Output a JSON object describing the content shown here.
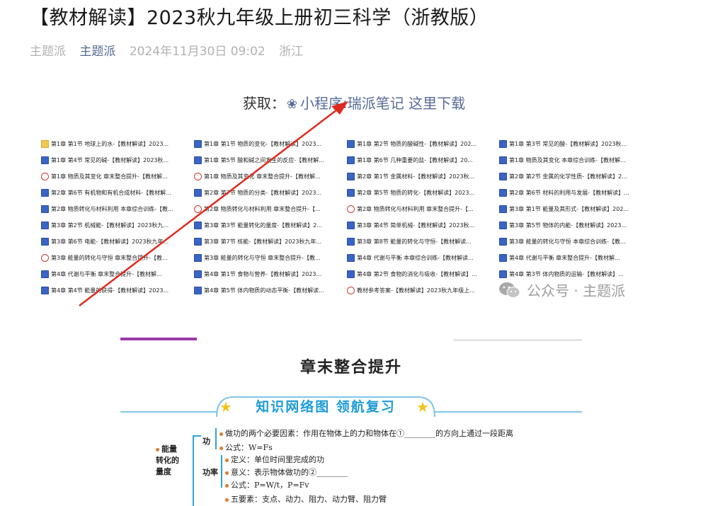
{
  "article": {
    "title": "【教材解读】2023秋九年级上册初三科学（浙教版）",
    "author": "主题派",
    "account": "主题派",
    "datetime": "2024年11月30日 09:02",
    "location": "浙江"
  },
  "get_line": {
    "label": "获取：",
    "icon": "link-icon",
    "link_text": "小程序:瑞派笔记 这里下载"
  },
  "files": {
    "columns": [
      [
        {
          "type": "folder",
          "name": "第1章 第1节 地球上的水-【教材解读】2023..."
        },
        {
          "type": "word",
          "name": "第1章 第4节 常见的碱-【教材解读】2023秋..."
        },
        {
          "type": "pdf",
          "name": "第1章 物质及其变化 章末整合提升-【教材解..."
        },
        {
          "type": "word",
          "name": "第2章 第6节 有机物和有机合成材料-【教材解..."
        },
        {
          "type": "word",
          "name": "第2章 物质转化与材料利用 本章综合训练-【教..."
        },
        {
          "type": "word",
          "name": "第3章 第2节 机械能-【教材解读】2023秋九..."
        },
        {
          "type": "word",
          "name": "第3章 第6节 电能-【教材解读】2023秋九年..."
        },
        {
          "type": "pdf",
          "name": "第3章 能量的转化与守恒 章末整合提升-【教..."
        },
        {
          "type": "word",
          "name": "第4章 代谢与平衡 章末整合提升-【教材解..."
        },
        {
          "type": "word",
          "name": "第4章 第4节 能量的获得-【教材解读】2023..."
        }
      ],
      [
        {
          "type": "word",
          "name": "第1章 第1节 物质的变化-【教材解读】2023..."
        },
        {
          "type": "word",
          "name": "第1章 第5节 酸和碱之间发生的反应-【教材解..."
        },
        {
          "type": "pdf",
          "name": "第1章 物质及其变化 章末整合提升-【教材解..."
        },
        {
          "type": "word",
          "name": "第2章 第7节 物质的分类-【教材解读】2023..."
        },
        {
          "type": "pdf",
          "name": "第2章 物质转化与材料利用 章末整合提升-【..."
        },
        {
          "type": "word",
          "name": "第3章 第3节 能量转化的量度-【教材解读】2..."
        },
        {
          "type": "word",
          "name": "第3章 第7节 核能-【教材解读】2023秋九年..."
        },
        {
          "type": "word",
          "name": "第3章 能量的转化与守恒 章末整合提升-【教..."
        },
        {
          "type": "word",
          "name": "第4章 第1节 食物与营养-【教材解读】2023..."
        },
        {
          "type": "word",
          "name": "第4章 第5节 体内物质的动态平衡-【教材解读..."
        }
      ],
      [
        {
          "type": "word",
          "name": "第1章 第2节 物质的酸碱性-【教材解读】202..."
        },
        {
          "type": "word",
          "name": "第1章 第6节 几种重要的盐-【教材解读】20..."
        },
        {
          "type": "word",
          "name": "第2章 第1节 金属材料-【教材解读】2023秋..."
        },
        {
          "type": "word",
          "name": "第2章 第5节 物质的转化-【教材解读】2023..."
        },
        {
          "type": "pdf",
          "name": "第2章 物质转化与材料利用 章末整合提升-【..."
        },
        {
          "type": "word",
          "name": "第3章 第4节 简单机械-【教材解读】2023秋..."
        },
        {
          "type": "word",
          "name": "第3章 第8节 能量的转化与守恒-【教材解读..."
        },
        {
          "type": "word",
          "name": "第4章 代谢与平衡 本章综合训练-【教材解读..."
        },
        {
          "type": "word",
          "name": "第4章 第2节 食物的消化与吸收-【教材解读】..."
        },
        {
          "type": "pdf",
          "name": "教材参考答案-【教材解读】2023秋九年级上..."
        }
      ],
      [
        {
          "type": "word",
          "name": "第1章 第3节 常见的酸-【教材解读】2023秋..."
        },
        {
          "type": "word",
          "name": "第1章 物质及其变化 本章综合训练-【教材解..."
        },
        {
          "type": "word",
          "name": "第2章 第2节 金属的化学性质-【教材解读】2..."
        },
        {
          "type": "word",
          "name": "第2章 第6节 材料的利用与发展-【教材解读】..."
        },
        {
          "type": "word",
          "name": "第3章 第1节 能量及其形式-【教材解读】202..."
        },
        {
          "type": "word",
          "name": "第3章 第5节 物体的内能-【教材解读】2023..."
        },
        {
          "type": "word",
          "name": "第3章 能量的转化与守恒 本章综合训练-【教..."
        },
        {
          "type": "word",
          "name": "第4章 代谢与平衡 章末整合提升-【教材解..."
        },
        {
          "type": "word",
          "name": "第4章 第3节 体内物质的运输-【教材解读】..."
        }
      ]
    ]
  },
  "watermark": {
    "icon": "wechat-icon",
    "text": "公众号 · 主题派"
  },
  "doc_preview": {
    "title": "章末整合提升",
    "banner": "知识网络图  领航复习",
    "mindmap": {
      "root": "能量转化的量度",
      "work": {
        "label": "功",
        "line1": "做功的两个必要因素：作用在物体上的力和物体在①________的方向上通过一段距离",
        "line2": "公式：W=Fs"
      },
      "power": {
        "label": "功率",
        "line1": "定义：单位时间里完成的功",
        "line2": "意义：表示物体做功的②________",
        "line3": "公式：P=W/t，P=Fv"
      },
      "lever": {
        "line1": "五要素：支点、动力、阻力、动力臂、阻力臂"
      }
    }
  },
  "colors": {
    "accent_link": "#576b95",
    "arrow": "#e02a1f",
    "banner_blue": "#1e9bd7",
    "word_icon": "#3a64c5",
    "pdf_icon": "#d23b2f",
    "folder_icon": "#f2c94c"
  }
}
